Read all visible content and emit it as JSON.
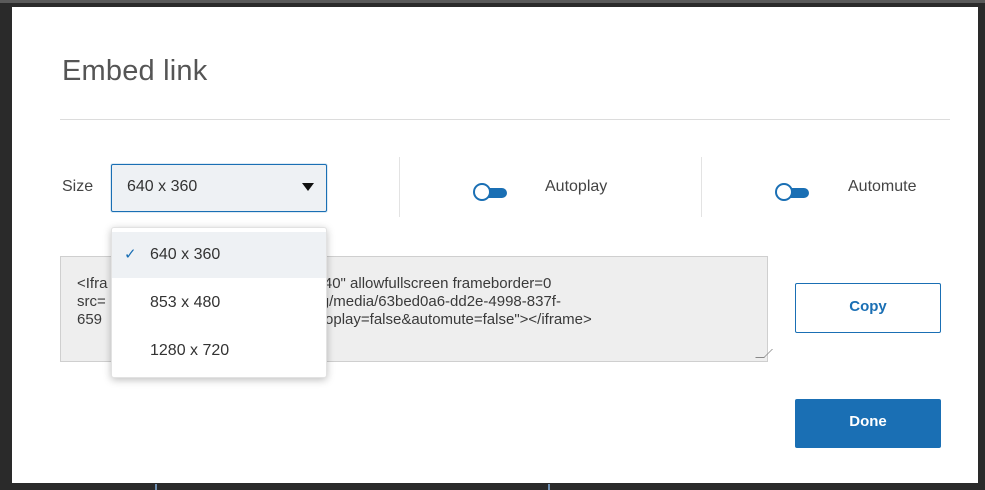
{
  "modal": {
    "title": "Embed link"
  },
  "size": {
    "label": "Size",
    "selected": "640 x 360",
    "options": [
      {
        "label": "640 x 360",
        "selected": true
      },
      {
        "label": "853 x 480",
        "selected": false
      },
      {
        "label": "1280 x 720",
        "selected": false
      }
    ]
  },
  "toggles": {
    "autoplay": {
      "label": "Autoplay",
      "on": false
    },
    "automute": {
      "label": "Automute",
      "on": false
    }
  },
  "embed": {
    "line1_left": "<Ifra",
    "line1_right": "=\"640\" allowfullscreen frameborder=0",
    "line2_left": "src=",
    "line2_right": "g/media/63bed0a6-dd2e-4998-837f-",
    "line3_left": "659",
    "line3_right": "oplay=false&automute=false\"></iframe>"
  },
  "buttons": {
    "copy": "Copy",
    "done": "Done"
  },
  "colors": {
    "accent": "#1a6fb4",
    "embed_bg": "#eeeeee",
    "select_bg": "#eef1f4"
  },
  "icons": {
    "dropdown_caret": "chevron-down-icon",
    "selected_check": "check-icon",
    "resize": "resize-grip-icon"
  }
}
